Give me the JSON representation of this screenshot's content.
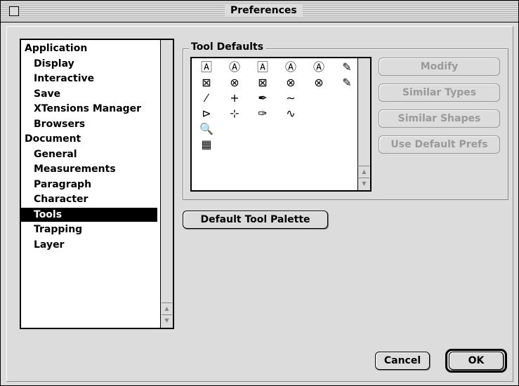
{
  "window": {
    "title": "Preferences"
  },
  "categories": [
    {
      "label": "Application",
      "indent": 0,
      "selected": false
    },
    {
      "label": "Display",
      "indent": 1,
      "selected": false
    },
    {
      "label": "Interactive",
      "indent": 1,
      "selected": false
    },
    {
      "label": "Save",
      "indent": 1,
      "selected": false
    },
    {
      "label": "XTensions Manager",
      "indent": 1,
      "selected": false
    },
    {
      "label": "Browsers",
      "indent": 1,
      "selected": false
    },
    {
      "label": "Document",
      "indent": 0,
      "selected": false
    },
    {
      "label": "General",
      "indent": 1,
      "selected": false
    },
    {
      "label": "Measurements",
      "indent": 1,
      "selected": false
    },
    {
      "label": "Paragraph",
      "indent": 1,
      "selected": false
    },
    {
      "label": "Character",
      "indent": 1,
      "selected": false
    },
    {
      "label": "Tools",
      "indent": 1,
      "selected": true
    },
    {
      "label": "Trapping",
      "indent": 1,
      "selected": false
    },
    {
      "label": "Layer",
      "indent": 1,
      "selected": false
    }
  ],
  "tool_defaults": {
    "title": "Tool Defaults",
    "tools": [
      {
        "name": "rect-text-box-icon",
        "glyph": "🄰"
      },
      {
        "name": "rounded-text-box-icon",
        "glyph": "Ⓐ"
      },
      {
        "name": "concave-text-box-icon",
        "glyph": "🄰"
      },
      {
        "name": "bevel-text-box-icon",
        "glyph": "Ⓐ"
      },
      {
        "name": "oval-text-box-icon",
        "glyph": "Ⓐ"
      },
      {
        "name": "bezier-text-box-icon",
        "glyph": "✎"
      },
      {
        "name": "rect-picture-box-icon",
        "glyph": "⊠"
      },
      {
        "name": "rounded-picture-box-icon",
        "glyph": "⊗"
      },
      {
        "name": "concave-picture-box-icon",
        "glyph": "⊠"
      },
      {
        "name": "bevel-picture-box-icon",
        "glyph": "⊗"
      },
      {
        "name": "oval-picture-box-icon",
        "glyph": "⊗"
      },
      {
        "name": "bezier-picture-box-icon",
        "glyph": "✎"
      },
      {
        "name": "line-tool-icon",
        "glyph": "⁄"
      },
      {
        "name": "orthogonal-line-icon",
        "glyph": "+"
      },
      {
        "name": "bezier-line-icon",
        "glyph": "✒"
      },
      {
        "name": "freehand-line-icon",
        "glyph": "∼"
      },
      {
        "name": "text-path-icon",
        "glyph": "⊳"
      },
      {
        "name": "orthogonal-text-path-icon",
        "glyph": "⊹"
      },
      {
        "name": "bezier-text-path-icon",
        "glyph": "✑"
      },
      {
        "name": "freehand-text-path-icon",
        "glyph": "∿"
      },
      {
        "name": "zoom-tool-icon",
        "glyph": "🔍"
      },
      {
        "name": "table-tool-icon",
        "glyph": "▦"
      }
    ]
  },
  "buttons": {
    "modify": "Modify",
    "similar_types": "Similar Types",
    "similar_shapes": "Similar Shapes",
    "use_default_prefs": "Use Default Prefs",
    "default_tool_palette": "Default Tool Palette",
    "cancel": "Cancel",
    "ok": "OK"
  }
}
